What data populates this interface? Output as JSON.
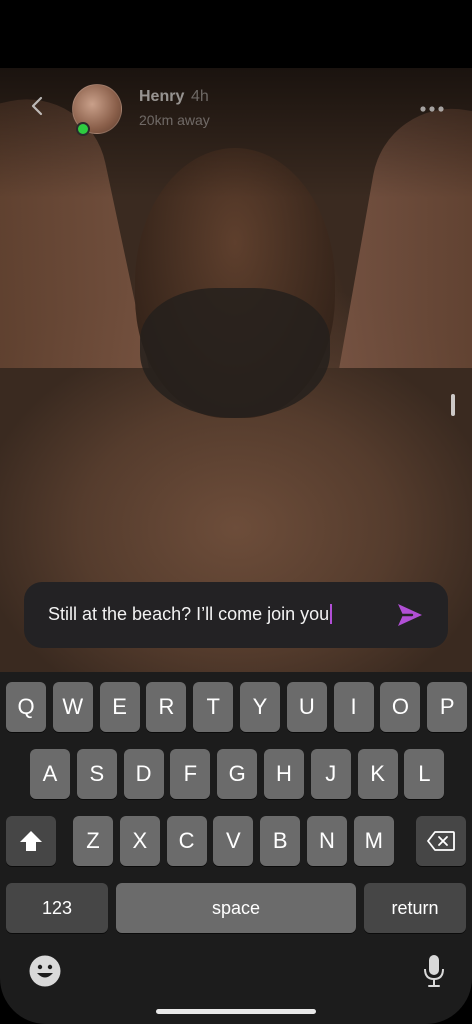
{
  "header": {
    "back_icon": "chevron-left-icon",
    "name": "Henry",
    "time": "4h",
    "distance": "20km away",
    "online": true,
    "more_icon": "more-dots-icon"
  },
  "composer": {
    "text": "Still at the beach? I’ll come join you",
    "send_icon": "send-icon",
    "accent": "#b14fd6"
  },
  "keyboard": {
    "row1": [
      "Q",
      "W",
      "E",
      "R",
      "T",
      "Y",
      "U",
      "I",
      "O",
      "P"
    ],
    "row2": [
      "A",
      "S",
      "D",
      "F",
      "G",
      "H",
      "J",
      "K",
      "L"
    ],
    "row3": [
      "Z",
      "X",
      "C",
      "V",
      "B",
      "N",
      "M"
    ],
    "shift_icon": "shift-icon",
    "delete_icon": "delete-icon",
    "numbers_label": "123",
    "space_label": "space",
    "return_label": "return",
    "emoji_icon": "emoji-icon",
    "mic_icon": "microphone-icon"
  }
}
